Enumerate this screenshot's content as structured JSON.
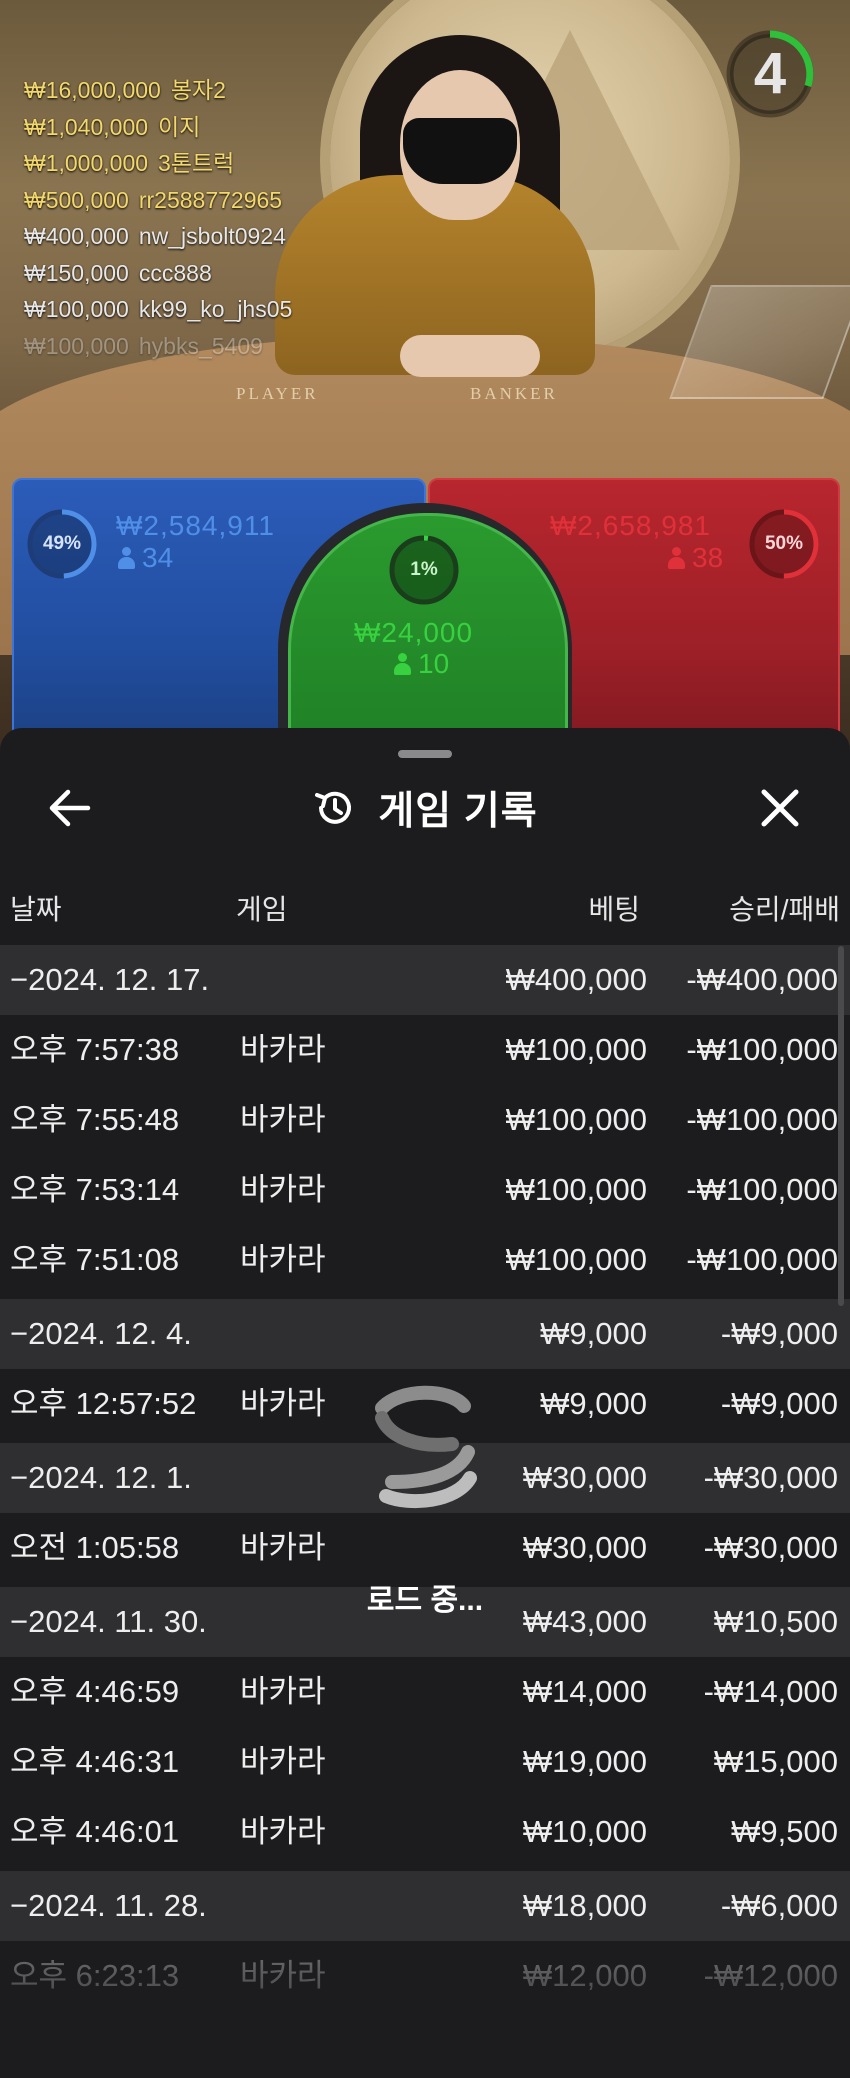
{
  "stream": {
    "table_labels": {
      "player": "PLAYER",
      "banker": "BANKER"
    },
    "countdown": "4",
    "bet_feed": [
      {
        "amount": "₩16,000,000",
        "name": "봉자2",
        "style": "gold"
      },
      {
        "amount": "₩1,040,000",
        "name": "이지",
        "style": "gold"
      },
      {
        "amount": "₩1,000,000",
        "name": "3톤트럭",
        "style": "gold"
      },
      {
        "amount": "₩500,000",
        "name": "rr2588772965",
        "style": "gold"
      },
      {
        "amount": "₩400,000",
        "name": "nw_jsbolt0924",
        "style": "gray"
      },
      {
        "amount": "₩150,000",
        "name": "ccc888",
        "style": "gray"
      },
      {
        "amount": "₩100,000",
        "name": "kk99_ko_jhs05",
        "style": "gray"
      },
      {
        "amount": "₩100,000",
        "name": "hybks_5409",
        "style": "fade"
      }
    ],
    "zones": {
      "player": {
        "pct": "49%",
        "amount": "₩2,584,911",
        "count": "34",
        "color": "#4f8fe8",
        "pct_value": 0.49
      },
      "tie": {
        "pct": "1%",
        "amount": "₩24,000",
        "count": "10",
        "color": "#38d13f",
        "pct_value": 0.01
      },
      "banker": {
        "pct": "50%",
        "amount": "₩2,658,981",
        "count": "38",
        "color": "#e0313a",
        "pct_value": 0.5
      }
    }
  },
  "sheet": {
    "title": "게임 기록",
    "icons": {
      "back": "arrow-left-icon",
      "close": "close-icon",
      "title": "history-icon",
      "loader": "spinner-icon"
    },
    "columns": {
      "date": "날짜",
      "game": "게임",
      "bet": "베팅",
      "result": "승리/패배"
    },
    "rows": [
      {
        "type": "group",
        "date": "−2024. 12. 17.",
        "game": "",
        "bet": "₩400,000",
        "result": "-₩400,000"
      },
      {
        "type": "entry",
        "date": "오후 7:57:38",
        "game": "바카라",
        "bet": "₩100,000",
        "result": "-₩100,000"
      },
      {
        "type": "entry",
        "date": "오후 7:55:48",
        "game": "바카라",
        "bet": "₩100,000",
        "result": "-₩100,000"
      },
      {
        "type": "entry",
        "date": "오후 7:53:14",
        "game": "바카라",
        "bet": "₩100,000",
        "result": "-₩100,000"
      },
      {
        "type": "entry",
        "date": "오후 7:51:08",
        "game": "바카라",
        "bet": "₩100,000",
        "result": "-₩100,000"
      },
      {
        "type": "group",
        "date": "−2024. 12. 4.",
        "game": "",
        "bet": "₩9,000",
        "result": "-₩9,000"
      },
      {
        "type": "entry",
        "date": "오후 12:57:52",
        "game": "바카라",
        "bet": "₩9,000",
        "result": "-₩9,000"
      },
      {
        "type": "group",
        "date": "−2024. 12. 1.",
        "game": "",
        "bet": "₩30,000",
        "result": "-₩30,000"
      },
      {
        "type": "entry",
        "date": "오전 1:05:58",
        "game": "바카라",
        "bet": "₩30,000",
        "result": "-₩30,000"
      },
      {
        "type": "group",
        "date": "−2024. 11. 30.",
        "game": "",
        "bet": "₩43,000",
        "result": "₩10,500"
      },
      {
        "type": "entry",
        "date": "오후 4:46:59",
        "game": "바카라",
        "bet": "₩14,000",
        "result": "-₩14,000"
      },
      {
        "type": "entry",
        "date": "오후 4:46:31",
        "game": "바카라",
        "bet": "₩19,000",
        "result": "₩15,000"
      },
      {
        "type": "entry",
        "date": "오후 4:46:01",
        "game": "바카라",
        "bet": "₩10,000",
        "result": "₩9,500"
      },
      {
        "type": "group",
        "date": "−2024. 11. 28.",
        "game": "",
        "bet": "₩18,000",
        "result": "-₩6,000"
      },
      {
        "type": "entry",
        "date": "오후 6:23:13",
        "game": "바카라",
        "bet": "₩12,000",
        "result": "-₩12,000"
      }
    ],
    "loading_text": "로드 중..."
  }
}
